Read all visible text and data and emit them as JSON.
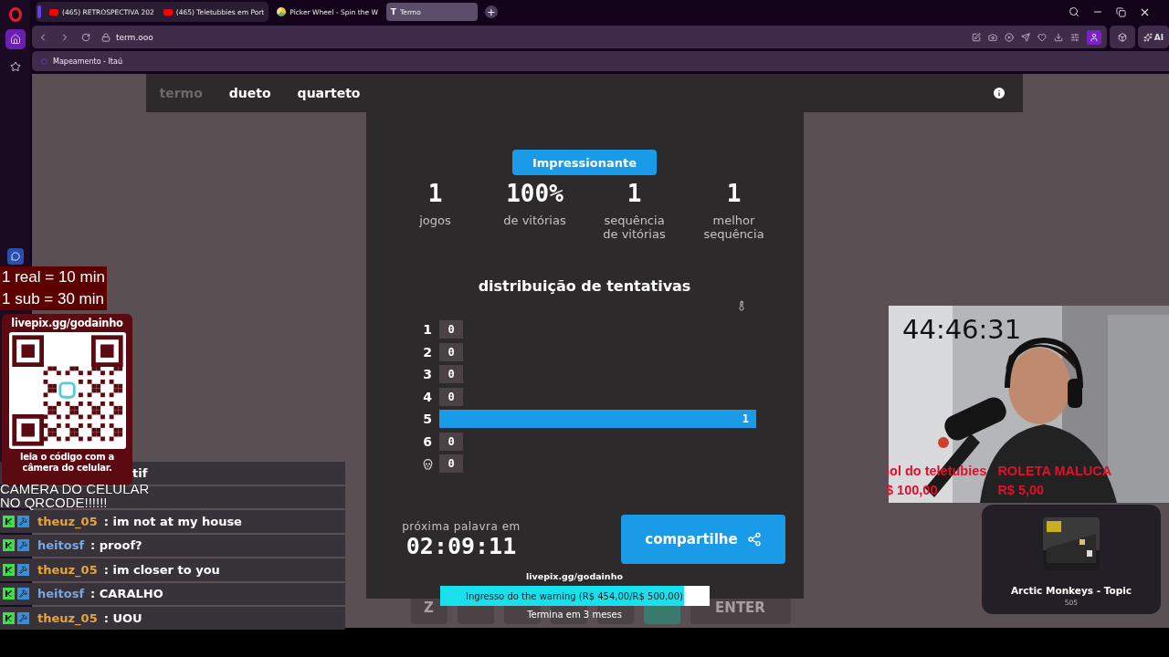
{
  "browser": {
    "tabs": [
      {
        "title": "(465) RETROSPECTIVA 202",
        "kind": "video",
        "grouped": true,
        "selected": false
      },
      {
        "title": "(465) Teletubbies em Port",
        "kind": "video",
        "grouped": true,
        "selected": false
      },
      {
        "title": "Picker Wheel - Spin the W",
        "kind": "wheel",
        "grouped": false,
        "selected": false
      },
      {
        "title": "Termo",
        "kind": "letter",
        "icon_text": "T",
        "grouped": false,
        "selected": true
      }
    ],
    "new_tab": "+",
    "url": "term.ooo",
    "ai_label": "AI",
    "bookmark": "Mapeamento - Itaú"
  },
  "termo": {
    "nav": [
      {
        "label": "termo",
        "selected": true
      },
      {
        "label": "dueto",
        "selected": false
      },
      {
        "label": "quarteto",
        "selected": false
      }
    ],
    "keys": [
      {
        "label": "Z",
        "correct": false
      },
      {
        "correct": false
      },
      {
        "correct": false
      },
      {
        "correct": false
      },
      {
        "correct": false
      },
      {
        "correct": true
      },
      {
        "label": "ENTER",
        "correct": false
      }
    ],
    "modal": {
      "toast": "Impressionante",
      "stats": [
        {
          "value": "1",
          "label": "jogos"
        },
        {
          "value": "100%",
          "label": "de vitórias"
        },
        {
          "value": "1",
          "label": "sequência\nde vitórias"
        },
        {
          "value": "1",
          "label": "melhor\nsequência"
        }
      ],
      "distribution_title": "distribuição de tentativas",
      "distribution": [
        {
          "kind": "number",
          "label": "1",
          "count": "0",
          "selected": false
        },
        {
          "kind": "number",
          "label": "2",
          "count": "0",
          "selected": false
        },
        {
          "kind": "number",
          "label": "3",
          "count": "0",
          "selected": false
        },
        {
          "kind": "number",
          "label": "4",
          "count": "0",
          "selected": false
        },
        {
          "kind": "number",
          "label": "5",
          "count": "1",
          "selected": true
        },
        {
          "kind": "number",
          "label": "6",
          "count": "0",
          "selected": false
        },
        {
          "kind": "skull",
          "count": "0",
          "selected": false
        }
      ],
      "next_label": "próxima palavra em",
      "countdown": "02:09:11",
      "share": "compartilhe"
    }
  },
  "overlay": {
    "rates": [
      "1 real = 10 min",
      "1 sub = 30 min"
    ],
    "qr": {
      "title": "livepix.gg/godainho",
      "caption": "leia o código com a câmera do celular."
    },
    "chat": [
      {
        "message": "tif"
      },
      {
        "covered": true
      },
      {
        "user": "theuz_05",
        "color": "#e7a43a",
        "message": ": im not at my house"
      },
      {
        "user": "heitosf",
        "color": "#7aa6e0",
        "message": ": proof?"
      },
      {
        "user": "theuz_05",
        "color": "#e7a43a",
        "message": ": im closer to you"
      },
      {
        "user": "heitosf",
        "color": "#7aa6e0",
        "message": ": CARALHO"
      },
      {
        "user": "theuz_05",
        "color": "#e7a43a",
        "message": ": UOU"
      }
    ],
    "shout": [
      "CAMERA DO CELULAR",
      "NO QRCODE!!!!!!"
    ],
    "webcam": {
      "kind": "picture",
      "timer": "44:46:31",
      "goals": [
        {
          "name": "iol do teletubies",
          "price": "$ 100,00"
        },
        {
          "name": "ROLETA MALUCA",
          "price": "R$ 5,00"
        }
      ]
    },
    "goal": {
      "link": "livepix.gg/godainho",
      "text": "Ingresso do the warning (R$ 454,00/R$ 500,00)",
      "level": 0.908,
      "ends": "Termina em 3 meses"
    },
    "music": {
      "title": "Arctic Monkeys - Topic",
      "count": "505"
    }
  }
}
